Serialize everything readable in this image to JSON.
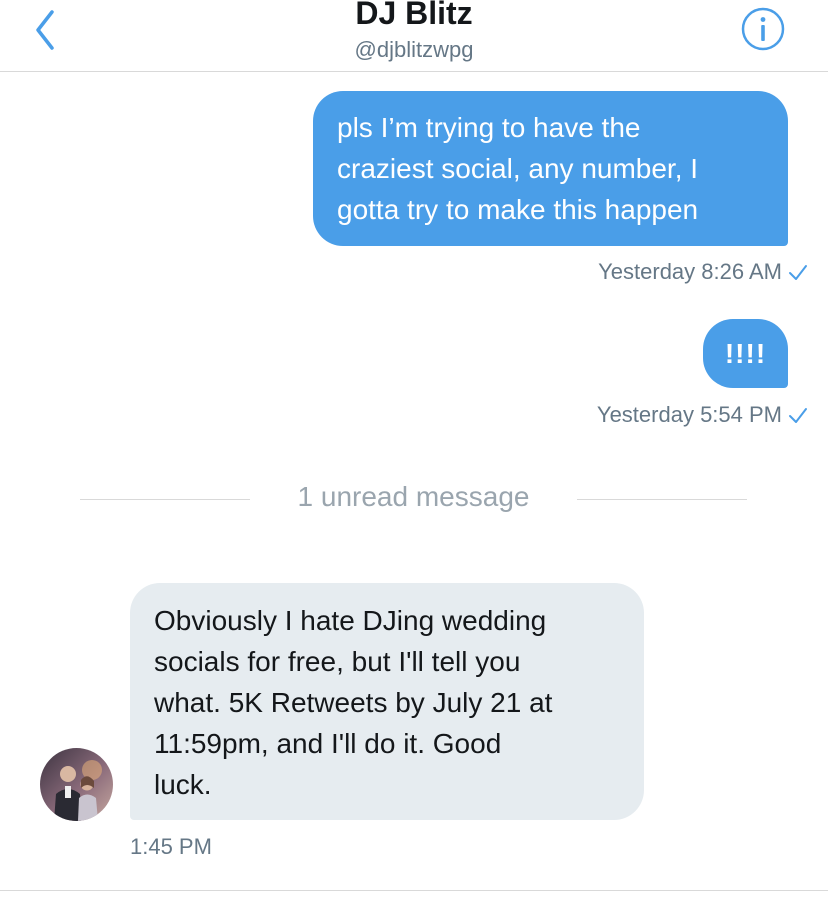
{
  "header": {
    "title": "DJ Blitz",
    "handle": "@djblitzwpg",
    "back_icon": "chevron-left-icon",
    "info_icon": "info-icon"
  },
  "colors": {
    "accent": "#4a9ee8",
    "incoming_bubble": "#e6ecf0",
    "secondary_text": "#657786",
    "divider": "#d9d9d9"
  },
  "messages": [
    {
      "direction": "outgoing",
      "lines": [
        "pls I’m trying to have the",
        "craziest social, any number, I",
        "gotta try to make this happen"
      ],
      "timestamp": "Yesterday 8:26 AM",
      "status_icon": "checkmark-icon"
    },
    {
      "direction": "outgoing",
      "lines": [
        "!!!!"
      ],
      "timestamp": "Yesterday 5:54 PM",
      "status_icon": "checkmark-icon"
    },
    {
      "direction": "incoming",
      "lines": [
        "Obviously I hate DJing wedding",
        "socials for free, but I'll tell you",
        "what. 5K Retweets by July 21 at",
        "11:59pm, and I'll do it. Good",
        "luck."
      ],
      "timestamp": "1:45 PM"
    }
  ],
  "unread_divider": {
    "label": "1 unread message"
  }
}
